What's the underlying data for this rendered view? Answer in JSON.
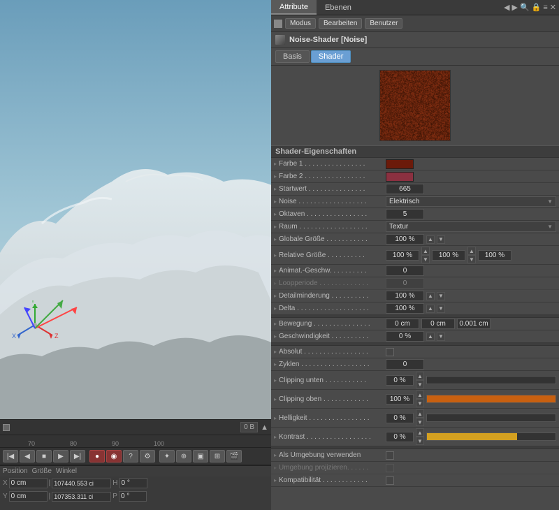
{
  "tabs": {
    "attribute": "Attribute",
    "ebenen": "Ebenen"
  },
  "toolbar": {
    "modus": "Modus",
    "bearbeiten": "Bearbeiten",
    "benutzer": "Benutzer"
  },
  "object": {
    "title": "Noise-Shader [Noise]"
  },
  "sub_tabs": {
    "basis": "Basis",
    "shader": "Shader"
  },
  "section": {
    "title": "Shader-Eigenschaften"
  },
  "properties": [
    {
      "label": "Farbe 1 . . . . . . . . . . . . . . . .",
      "type": "color",
      "color": "dark-red"
    },
    {
      "label": "Farbe 2 . . . . . . . . . . . . . . . .",
      "type": "color",
      "color": "dark-pink"
    },
    {
      "label": "Startwert . . . . . . . . . . . . . . .",
      "type": "number",
      "value": "665"
    },
    {
      "label": "Noise . . . . . . . . . . . . . . . . . .",
      "type": "dropdown",
      "value": "Elektrisch"
    },
    {
      "label": "Oktaven . . . . . . . . . . . . . . . .",
      "type": "number",
      "value": "5"
    },
    {
      "label": "Raum . . . . . . . . . . . . . . . . . .",
      "type": "dropdown",
      "value": "Textur"
    },
    {
      "label": "Globale Größe . . . . . . . . . . .",
      "type": "number_pct",
      "value": "100 %"
    },
    {
      "label": "Relative Größe . . . . . . . . . .",
      "type": "multi_pct",
      "values": [
        "100 %",
        "100 %",
        "100 %"
      ]
    },
    {
      "label": "Animat.-Geschw. . . . . . . . . .",
      "type": "number",
      "value": "0"
    },
    {
      "label": "Loopperiode . . . . . . . . . . . . .",
      "type": "number",
      "value": "0",
      "dimmed": true
    },
    {
      "label": "Detailminderung . . . . . . . . . .",
      "type": "number_pct",
      "value": "100 %"
    },
    {
      "label": "Delta . . . . . . . . . . . . . . . . . . .",
      "type": "number_pct",
      "value": "100 %"
    },
    {
      "label": "",
      "type": "spacer"
    },
    {
      "label": "Bewegung . . . . . . . . . . . . . . .",
      "type": "multi_cm",
      "values": [
        "0 cm",
        "0 cm",
        "0.001 cm"
      ]
    },
    {
      "label": "Geschwindigkeit . . . . . . . . . .",
      "type": "number_pct",
      "value": "0 %"
    },
    {
      "label": "",
      "type": "spacer"
    },
    {
      "label": "Absolut . . . . . . . . . . . . . . . . .",
      "type": "checkbox",
      "checked": false
    },
    {
      "label": "Zyklen . . . . . . . . . . . . . . . . . .",
      "type": "number",
      "value": "0"
    },
    {
      "label": "Clipping unten . . . . . . . . . . .",
      "type": "progress",
      "value": "0 %",
      "fill": 0,
      "fill_type": "none"
    },
    {
      "label": "Clipping oben . . . . . . . . . . . .",
      "type": "progress",
      "value": "100 %",
      "fill": 100,
      "fill_type": "orange"
    },
    {
      "label": "Helligkeit . . . . . . . . . . . . . . . .",
      "type": "progress",
      "value": "0 %",
      "fill": 0,
      "fill_type": "none"
    },
    {
      "label": "Kontrast . . . . . . . . . . . . . . . . .",
      "type": "progress",
      "value": "0 %",
      "fill": 70,
      "fill_type": "yellow"
    },
    {
      "label": "",
      "type": "spacer"
    },
    {
      "label": "Als Umgebung verwenden",
      "type": "checkbox",
      "checked": false
    },
    {
      "label": "Umgebung projizieren. . . . . .",
      "type": "checkbox",
      "checked": false,
      "dimmed": true
    },
    {
      "label": "Kompatibilität . . . . . . . . . . . .",
      "type": "checkbox",
      "checked": false
    }
  ],
  "timeline": {
    "markers": [
      "70",
      "80",
      "90",
      "100"
    ],
    "size_label": "0 B"
  },
  "coords": {
    "position_label": "Position",
    "size_label": "Größe",
    "angle_label": "Winkel",
    "x_pos": "0 cm",
    "y_pos": "0 cm",
    "x_size": "107440.553 ci",
    "y_size": "107353.311 ci",
    "h_angle": "0 °",
    "p_angle": "0 °"
  }
}
